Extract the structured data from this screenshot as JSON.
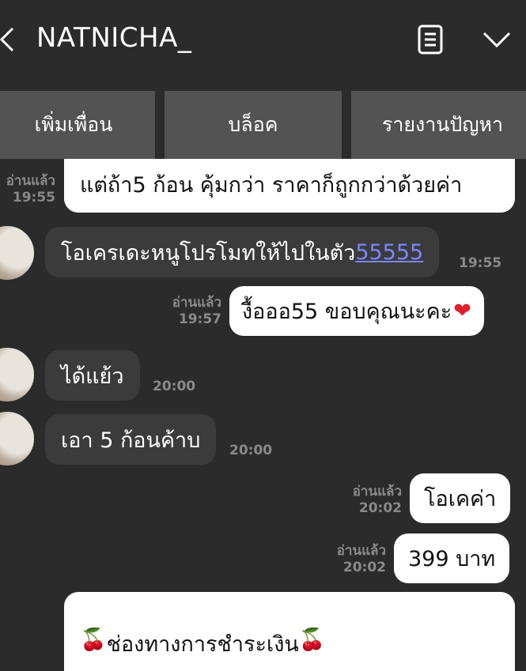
{
  "header": {
    "title": "NATNICHA_"
  },
  "actions": {
    "add_friend": "เพิ่มเพื่อน",
    "block": "บล็อค",
    "report": "รายงานปัญหา"
  },
  "messages": [
    {
      "read": "อ่านแล้ว",
      "time": "19:55",
      "text": "แต่ถ้า5 ก้อน คุ้มกว่า ราคาก็ถูกกว่าด้วยค่า"
    },
    {
      "text": "โอเครเดะหนูโปรโมทให้ไปในตัว",
      "link": "55555",
      "time": "19:55"
    },
    {
      "read": "อ่านแล้ว",
      "time": "19:57",
      "text": "งื้อออ55 ขอบคุณนะคะ"
    },
    {
      "text": "ได้แย้ว",
      "time": "20:00"
    },
    {
      "text": "เอา 5 ก้อนค้าบ",
      "time": "20:00"
    },
    {
      "read": "อ่านแล้ว",
      "time": "20:02",
      "text": "โอเคค่า"
    },
    {
      "read": "อ่านแล้ว",
      "time": "20:02",
      "text": "399 บาท"
    },
    {
      "text": "ช่องทางการชำระเงิน"
    }
  ],
  "icons": {
    "back": "chevron-left-icon",
    "note": "note-icon",
    "menu": "chevron-down-icon",
    "heart": "heart-emoji",
    "cherry": "cherry-emoji"
  },
  "colors": {
    "background": "#2b2b2b",
    "button": "#535353",
    "incoming": "#3b3b3b",
    "outgoing": "#ffffff",
    "link": "#7b86ff"
  }
}
